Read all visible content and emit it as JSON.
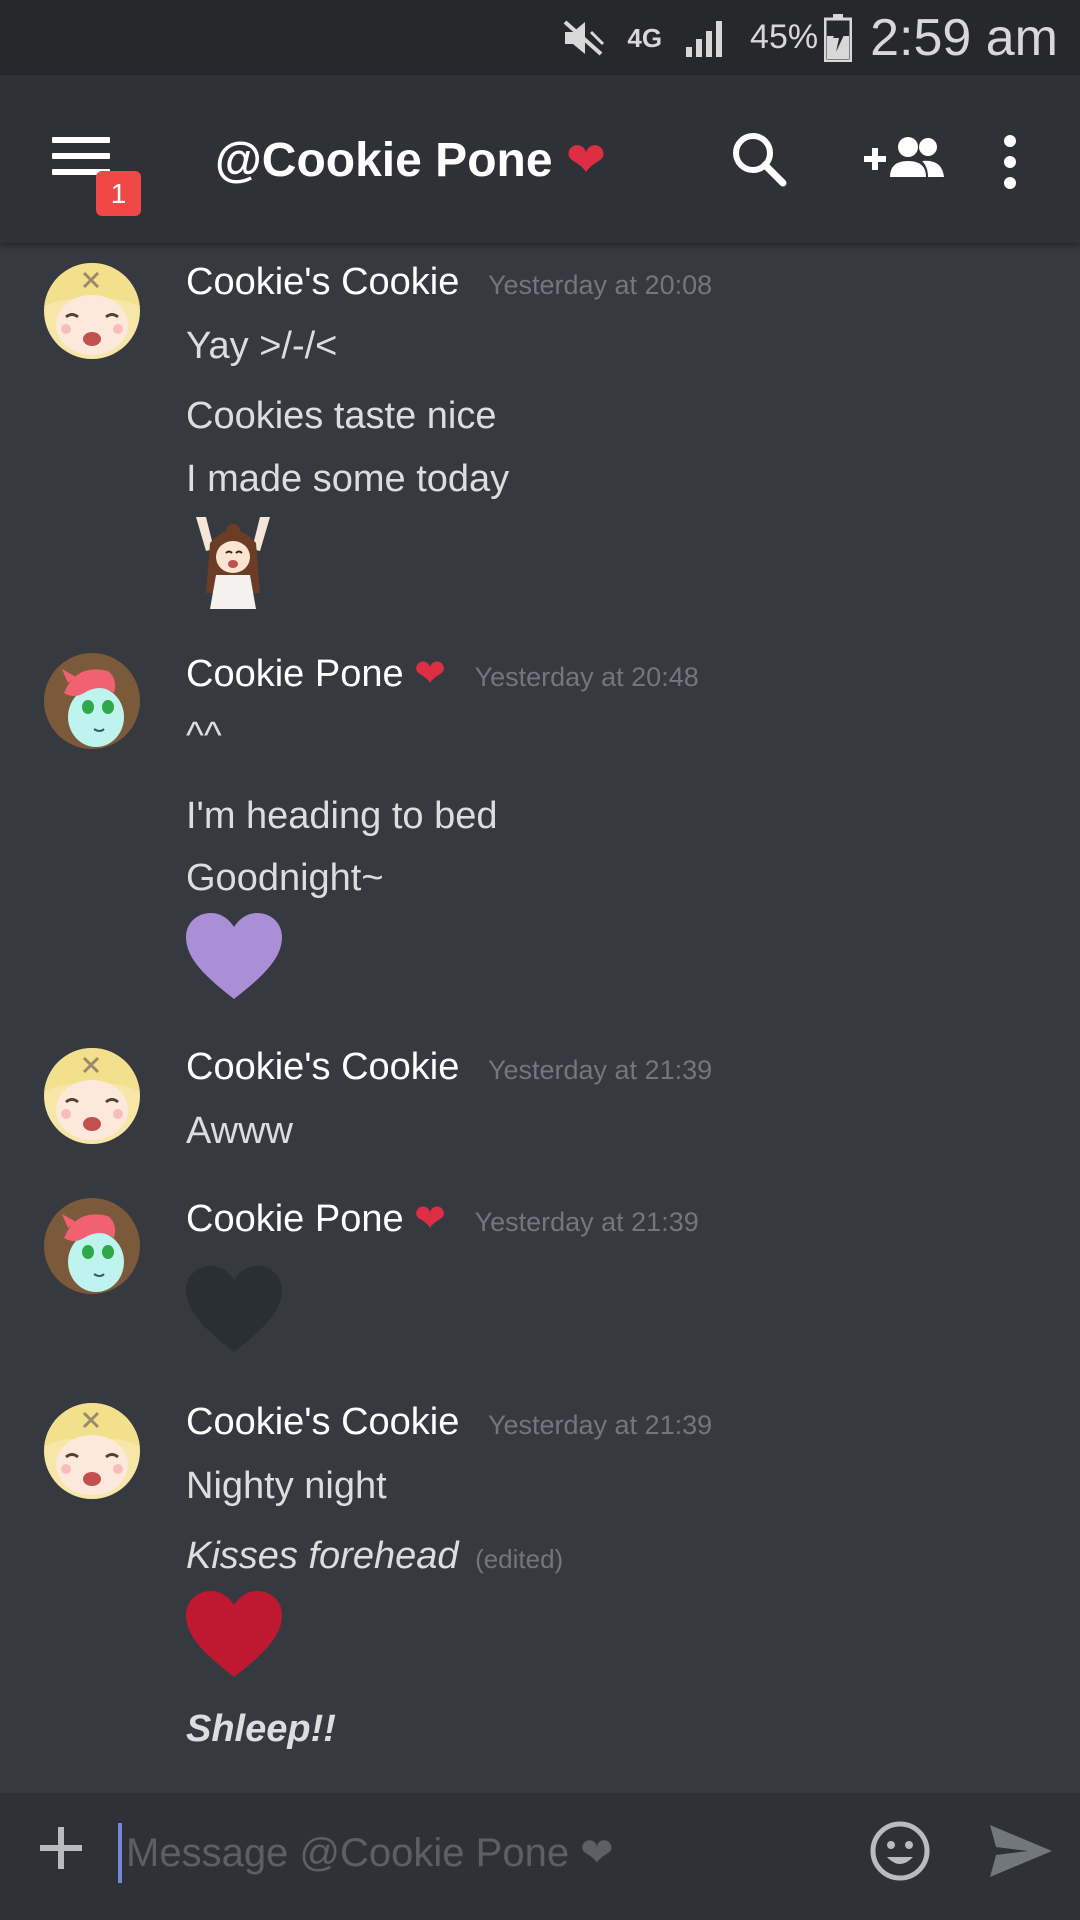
{
  "status_bar": {
    "network": "4G",
    "battery": "45%",
    "time": "2:59 am"
  },
  "header": {
    "title": "@Cookie Pone",
    "title_emoji": "❤",
    "notification_count": "1",
    "icons": [
      "menu-icon",
      "search-icon",
      "add-friend-icon",
      "more-vertical-icon"
    ]
  },
  "messages": [
    {
      "author": "Cookie's Cookie",
      "author_emoji": "",
      "timestamp": "Yesterday at 20:08",
      "lines": [
        "Yay >/-/<",
        "Cookies taste nice",
        "I made some today"
      ],
      "emoji": "cheering-girl-emoji"
    },
    {
      "author": "Cookie Pone",
      "author_emoji": "❤",
      "timestamp": "Yesterday at 20:48",
      "lines": [
        "^^",
        "I'm heading to bed",
        "Goodnight~"
      ],
      "emoji": "purple-heart-emoji"
    },
    {
      "author": "Cookie's Cookie",
      "author_emoji": "",
      "timestamp": "Yesterday at 21:39",
      "lines": [
        "Awww"
      ]
    },
    {
      "author": "Cookie Pone",
      "author_emoji": "❤",
      "timestamp": "Yesterday at 21:39",
      "emoji": "black-heart-emoji"
    },
    {
      "author": "Cookie's Cookie",
      "author_emoji": "",
      "timestamp": "Yesterday at 21:39",
      "lines": [
        "Nighty night"
      ],
      "italic_line": "Kisses forehead",
      "edited_label": "(edited)",
      "emoji": "red-heart-emoji",
      "bold_italic_line": "Shleep!!"
    }
  ],
  "input": {
    "placeholder": "Message @Cookie Pone ❤"
  },
  "colors": {
    "background": "#36393f",
    "header": "#2f3136",
    "status_bar": "#26282b",
    "badge": "#f04747",
    "accent": "#7289da",
    "purple_heart": "#aa8ed6",
    "black_heart": "#292f33",
    "red_heart": "#be1931"
  }
}
